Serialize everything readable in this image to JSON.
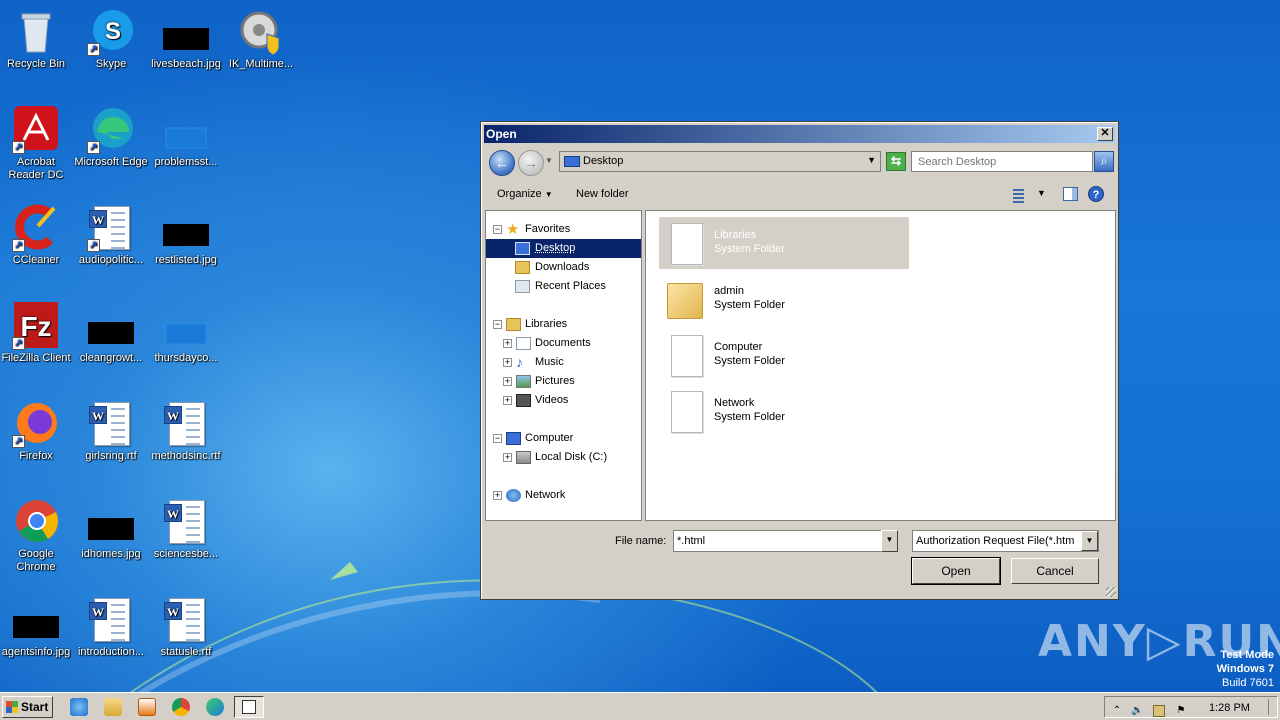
{
  "desktop": {
    "icons": [
      {
        "label": "Recycle Bin",
        "icon": "recycle-bin-icon"
      },
      {
        "label": "Skype",
        "icon": "skype-icon"
      },
      {
        "label": "livesbeach.jpg",
        "icon": "image-file-icon"
      },
      {
        "label": "IK_Multime...",
        "icon": "setup-icon"
      },
      {
        "label": "Acrobat Reader DC",
        "icon": "acrobat-icon"
      },
      {
        "label": "Microsoft Edge",
        "icon": "edge-icon"
      },
      {
        "label": "problemsst...",
        "icon": "file-icon"
      },
      {
        "label": "CCleaner",
        "icon": "ccleaner-icon"
      },
      {
        "label": "audiopolitic...",
        "icon": "word-doc-icon"
      },
      {
        "label": "restlisted.jpg",
        "icon": "image-file-icon"
      },
      {
        "label": "FileZilla Client",
        "icon": "filezilla-icon"
      },
      {
        "label": "cleangrowt...",
        "icon": "image-file-icon"
      },
      {
        "label": "thursdayco...",
        "icon": "file-icon"
      },
      {
        "label": "Firefox",
        "icon": "firefox-icon"
      },
      {
        "label": "girlsring.rtf",
        "icon": "word-doc-icon"
      },
      {
        "label": "methodsinc.rtf",
        "icon": "word-doc-icon"
      },
      {
        "label": "Google Chrome",
        "icon": "chrome-icon"
      },
      {
        "label": "idhomes.jpg",
        "icon": "image-file-icon"
      },
      {
        "label": "sciencesbe...",
        "icon": "word-doc-icon"
      },
      {
        "label": "agentsinfo.jpg",
        "icon": "image-file-icon"
      },
      {
        "label": "introduction...",
        "icon": "word-doc-icon"
      },
      {
        "label": "statusle.rtf",
        "icon": "word-doc-icon"
      }
    ]
  },
  "dialog": {
    "title": "Open",
    "close_label": "✕",
    "address": "Desktop",
    "search_placeholder": "Search Desktop",
    "toolbar": {
      "organize": "Organize",
      "new_folder": "New folder"
    },
    "nav": {
      "favorites": "Favorites",
      "desktop": "Desktop",
      "downloads": "Downloads",
      "recent": "Recent Places",
      "libraries": "Libraries",
      "documents": "Documents",
      "music": "Music",
      "pictures": "Pictures",
      "videos": "Videos",
      "computer": "Computer",
      "local_disk": "Local Disk (C:)",
      "network": "Network"
    },
    "items": [
      {
        "name": "Libraries",
        "type": "System Folder"
      },
      {
        "name": "admin",
        "type": "System Folder"
      },
      {
        "name": "Computer",
        "type": "System Folder"
      },
      {
        "name": "Network",
        "type": "System Folder"
      }
    ],
    "file_name_label": "File name:",
    "file_name_value": "*.html",
    "file_type_value": "Authorization Request File(*.htm",
    "open_label": "Open",
    "cancel_label": "Cancel"
  },
  "taskbar": {
    "start_label": "Start",
    "clock": "1:28 PM"
  },
  "watermark": {
    "brand": "ANY▷RUN",
    "line1": "Test Mode",
    "line2": "Windows 7",
    "line3": "Build 7601"
  }
}
